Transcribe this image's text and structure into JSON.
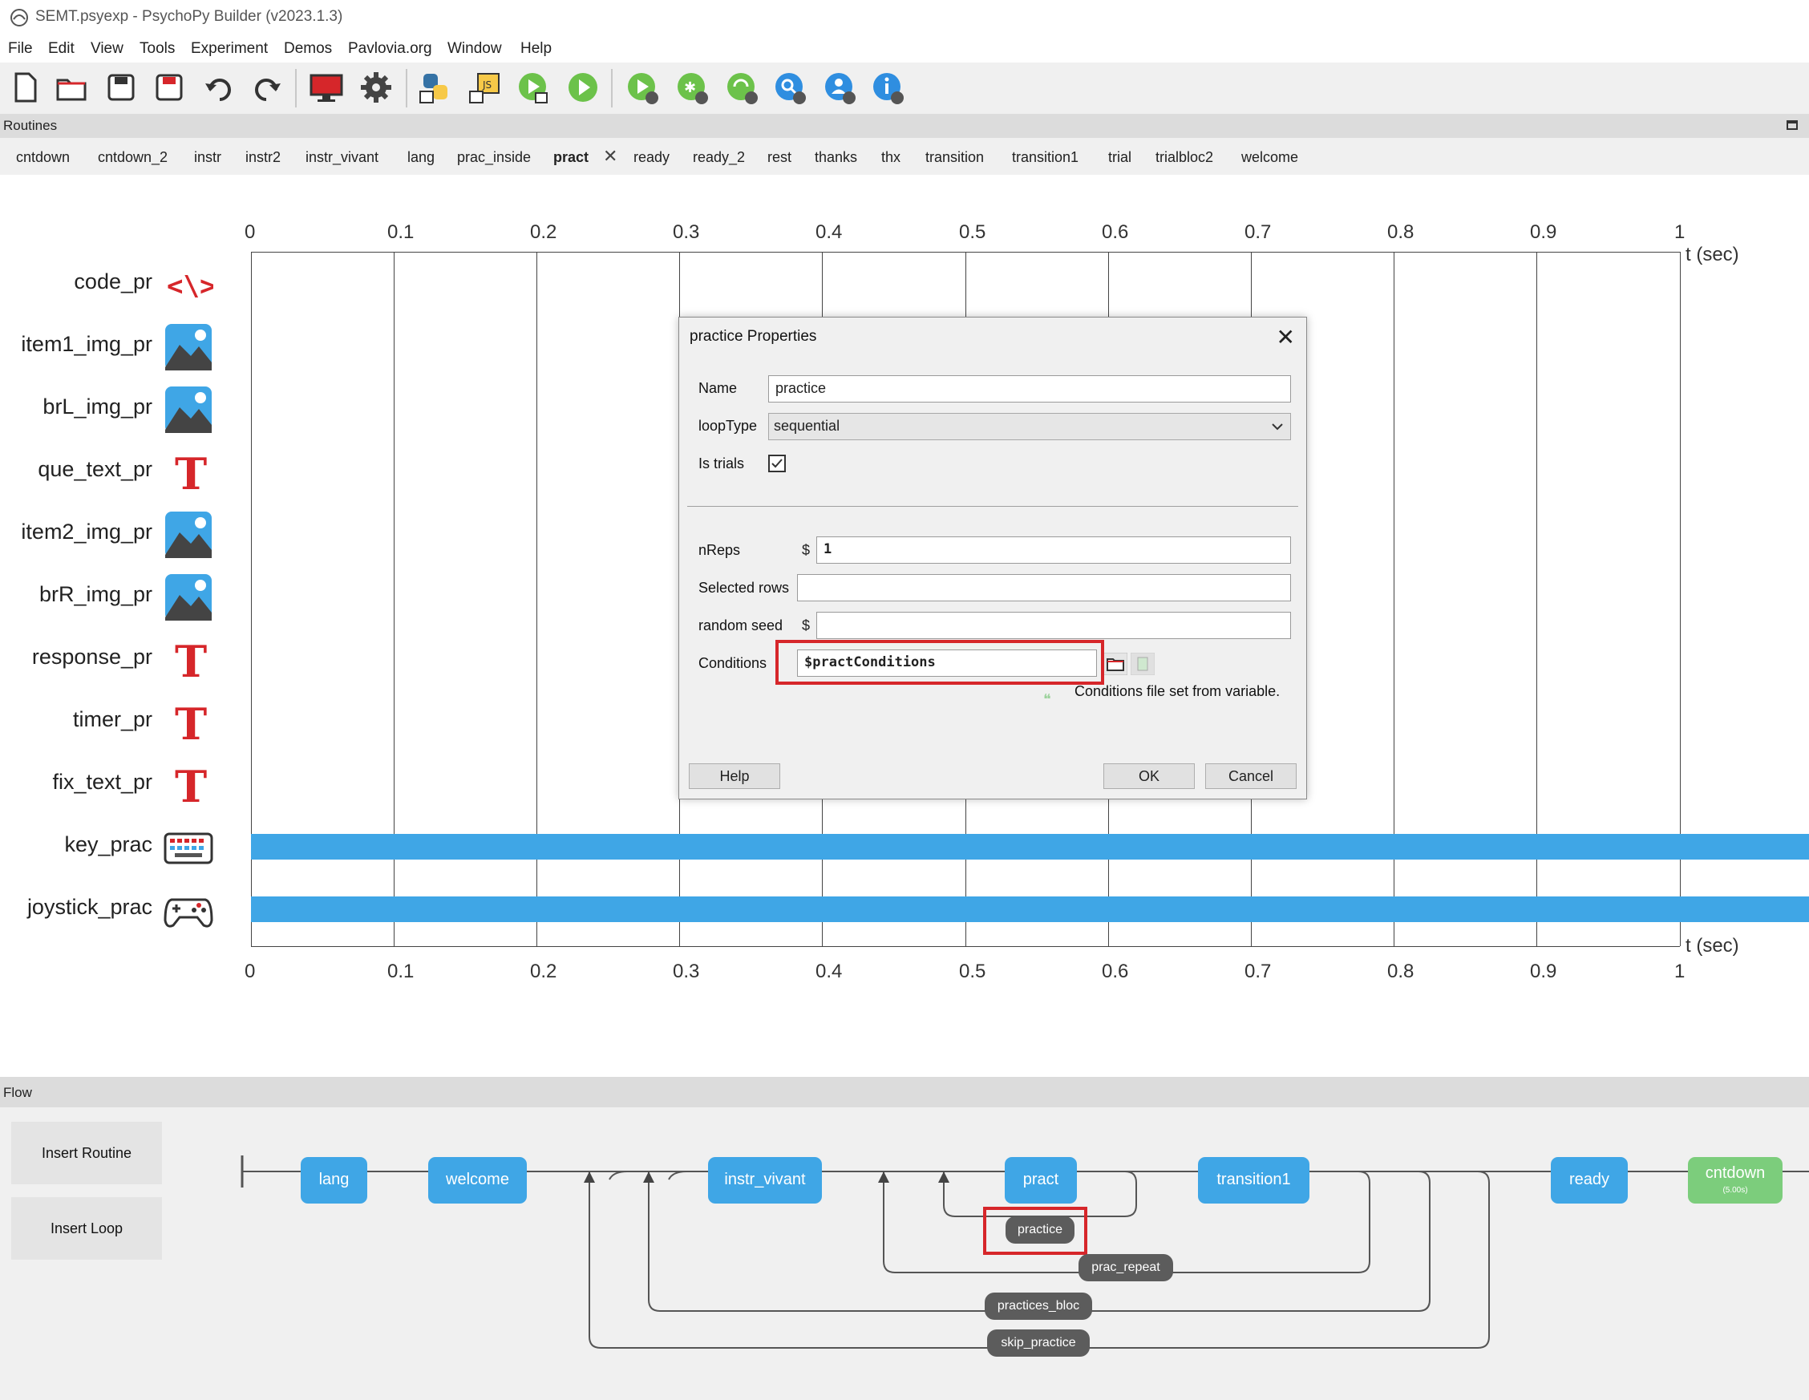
{
  "window": {
    "title": "SEMT.psyexp - PsychoPy Builder (v2023.1.3)"
  },
  "menu": [
    "File",
    "Edit",
    "View",
    "Tools",
    "Experiment",
    "Demos",
    "Pavlovia.org",
    "Window",
    "Help"
  ],
  "toolbar": {
    "icons": [
      "new-file-icon",
      "open-folder-icon",
      "save-icon",
      "save-as-icon",
      "undo-icon",
      "redo-icon",
      "monitor-icon",
      "settings-gear-icon",
      "python-compile-icon",
      "js-compile-icon",
      "run-experiment-icon",
      "run-icon",
      "pilot-run-icon",
      "debug-icon",
      "sync-icon",
      "search-pavlovia-icon",
      "user-icon",
      "info-icon"
    ]
  },
  "routines_panel": {
    "label": "Routines",
    "tabs": [
      "cntdown",
      "cntdown_2",
      "instr",
      "instr2",
      "instr_vivant",
      "lang",
      "prac_inside",
      "pract",
      "ready",
      "ready_2",
      "rest",
      "thanks",
      "thx",
      "transition",
      "transition1",
      "trial",
      "trialbloc2",
      "welcome"
    ],
    "active_tab": "pract",
    "close_glyph": "✕"
  },
  "timeline": {
    "ticks": [
      "0",
      "0.1",
      "0.2",
      "0.3",
      "0.4",
      "0.5",
      "0.6",
      "0.7",
      "0.8",
      "0.9",
      "1"
    ],
    "axis_label": "t (sec)",
    "components": [
      {
        "name": "code_pr",
        "icon": "code-icon"
      },
      {
        "name": "item1_img_pr",
        "icon": "image-icon"
      },
      {
        "name": "brL_img_pr",
        "icon": "image-icon"
      },
      {
        "name": "que_text_pr",
        "icon": "text-icon"
      },
      {
        "name": "item2_img_pr",
        "icon": "image-icon"
      },
      {
        "name": "brR_img_pr",
        "icon": "image-icon"
      },
      {
        "name": "response_pr",
        "icon": "text-icon"
      },
      {
        "name": "timer_pr",
        "icon": "text-icon"
      },
      {
        "name": "fix_text_pr",
        "icon": "text-icon"
      },
      {
        "name": "key_prac",
        "icon": "keyboard-icon"
      },
      {
        "name": "joystick_prac",
        "icon": "gamepad-icon"
      }
    ]
  },
  "dialog": {
    "title": "practice Properties",
    "name_label": "Name",
    "name_value": "practice",
    "looptype_label": "loopType",
    "looptype_value": "sequential",
    "istrials_label": "Is trials",
    "istrials_checked": true,
    "nreps_label": "nReps",
    "nreps_value": "1",
    "selected_rows_label": "Selected rows",
    "selected_rows_value": "",
    "random_seed_label": "random seed",
    "random_seed_value": "",
    "dollar": "$",
    "conditions_label": "Conditions",
    "conditions_value": "$practConditions",
    "conditions_note": "Conditions file set from variable.",
    "help_button": "Help",
    "ok_button": "OK",
    "cancel_button": "Cancel"
  },
  "flow_panel": {
    "label": "Flow",
    "insert_routine": "Insert Routine",
    "insert_loop": "Insert Loop",
    "routines": [
      {
        "label": "lang",
        "color": "#3fa6e6"
      },
      {
        "label": "welcome",
        "color": "#3fa6e6"
      },
      {
        "label": "instr_vivant",
        "color": "#3fa6e6"
      },
      {
        "label": "pract",
        "color": "#3fa6e6"
      },
      {
        "label": "transition1",
        "color": "#3fa6e6"
      },
      {
        "label": "ready",
        "color": "#3fa6e6"
      },
      {
        "label": "cntdown",
        "color": "#7ccd7c"
      }
    ],
    "cntdown_sub": "(5.00s)",
    "loops": [
      "practice",
      "prac_repeat",
      "practices_bloc",
      "skip_practice"
    ]
  },
  "colors": {
    "accent": "#3fa6e6",
    "highlight": "#d6262a",
    "loop": "#5c5c5c",
    "green": "#7ccd7c"
  }
}
